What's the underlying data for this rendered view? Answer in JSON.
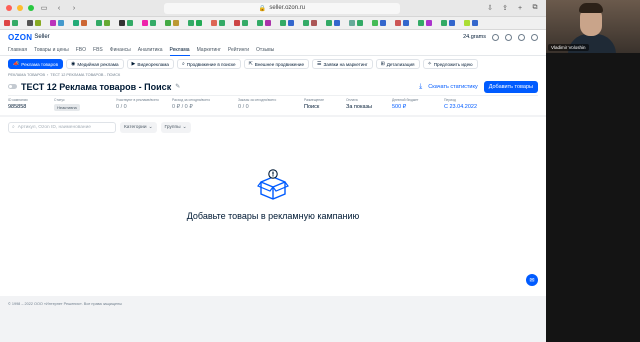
{
  "browser": {
    "url": "seller.ozon.ru",
    "bookmark_colors": [
      "#d44",
      "#3a6",
      "#555",
      "#8a2",
      "#b3b",
      "#49c",
      "#2a7",
      "#c63",
      "#3a6",
      "#6a3",
      "#333",
      "#3a6",
      "#e2a",
      "#3a6",
      "#4a4",
      "#b93",
      "#3a6",
      "#2a5",
      "#d65",
      "#3a6",
      "#c44",
      "#3a6",
      "#3a6",
      "#a3a",
      "#3a6",
      "#36c",
      "#3a6",
      "#a55",
      "#3a6",
      "#36c",
      "#6a9",
      "#3a6",
      "#4b5",
      "#36c",
      "#c55",
      "#36c",
      "#3a6",
      "#a3c",
      "#3a6",
      "#36c",
      "#ad3",
      "#36c"
    ]
  },
  "header": {
    "logo": "OZON",
    "logo_suffix": "Seller",
    "account": "24.grams"
  },
  "nav": {
    "items": [
      "Главная",
      "Товары и цены",
      "FBO",
      "FBS",
      "Финансы",
      "Аналитика",
      "Реклама",
      "Маркетинг",
      "Рейтинги",
      "Отзывы"
    ],
    "active": "Реклама"
  },
  "subnav": {
    "items": [
      {
        "label": "Реклама товаров",
        "icon": "megaphone-icon",
        "active": true
      },
      {
        "label": "Медийная реклама",
        "icon": "eye-icon",
        "active": false
      },
      {
        "label": "Видеореклама",
        "icon": "video-icon",
        "active": false
      },
      {
        "label": "Продвижение в поиске",
        "icon": "search-icon",
        "active": false
      },
      {
        "label": "Внешнее продвижение",
        "icon": "external-icon",
        "active": false
      },
      {
        "label": "Заявки на маркетинг",
        "icon": "list-icon",
        "active": false
      },
      {
        "label": "Детализация",
        "icon": "detail-icon",
        "active": false
      },
      {
        "label": "Предложить идею",
        "icon": "lightbulb-icon",
        "active": false
      }
    ]
  },
  "breadcrumb": {
    "parent": "Реклама товаров",
    "separator": "›",
    "current": "ТЕСТ 12 Реклама товаров - Поиск"
  },
  "campaign": {
    "title": "ТЕСТ 12 Реклама товаров - Поиск",
    "download_label": "Скачать статистику",
    "add_products_label": "Добавить товары"
  },
  "stats": [
    {
      "label": "ID кампании",
      "value": "985858",
      "style": ""
    },
    {
      "label": "Статус",
      "value": "Неактивна",
      "style": "badge"
    },
    {
      "label": "Участвуют в рекламе/всего",
      "value": "0 / 0",
      "style": "muted"
    },
    {
      "label": "Расход за сегодня/всего",
      "value": "0 ₽ / 0 ₽",
      "style": "muted"
    },
    {
      "label": "Заказы за сегодня/всего",
      "value": "0 / 0",
      "style": "muted"
    },
    {
      "label": "Размещение",
      "value": "Поиск",
      "style": ""
    },
    {
      "label": "Оплата",
      "value": "За показы",
      "style": ""
    },
    {
      "label": "Дневной бюджет",
      "value": "500 ₽",
      "style": "link"
    },
    {
      "label": "Период",
      "value": "С 23.04.2022",
      "style": "link"
    }
  ],
  "filters": {
    "search_placeholder": "Артикул, Ozon ID, наименование",
    "category": "Категории",
    "groups": "Группы"
  },
  "empty_state": {
    "text": "Добавьте товары в рекламную кампанию"
  },
  "footer": {
    "text": "© 1998 – 2022 ООО «Интернет Решения». Все права защищены"
  },
  "video": {
    "participant": "Vladimir Voloshin"
  }
}
